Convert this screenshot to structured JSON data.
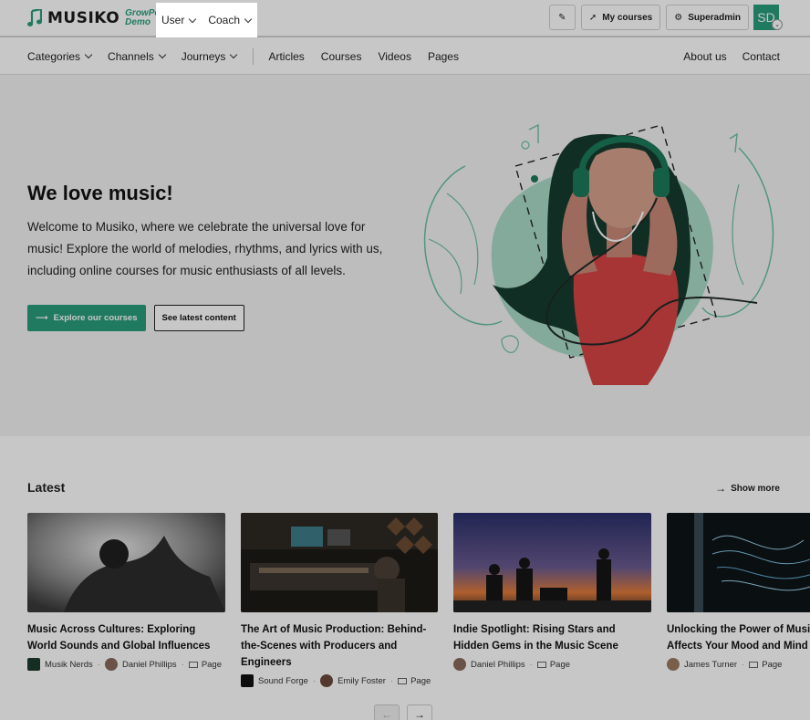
{
  "brand": {
    "name": "MUSIKO",
    "sub_line1": "GrowPoint",
    "sub_line2": "Demo"
  },
  "top_menu": {
    "user": "User",
    "coach": "Coach"
  },
  "top_actions": {
    "my_courses": "My courses",
    "superadmin": "Superadmin",
    "avatar_initials": "SD"
  },
  "nav": {
    "categories": "Categories",
    "channels": "Channels",
    "journeys": "Journeys",
    "articles": "Articles",
    "courses": "Courses",
    "videos": "Videos",
    "pages": "Pages",
    "about": "About us",
    "contact": "Contact"
  },
  "hero": {
    "title": "We love music!",
    "text": "Welcome to Musiko, where we celebrate the universal love for music! Explore the world of melodies, rhythms, and lyrics with us, including online courses for music enthusiasts of all levels.",
    "primary_btn": "Explore our courses",
    "secondary_btn": "See latest content"
  },
  "latest": {
    "title": "Latest",
    "show_more": "Show more",
    "cards": [
      {
        "title": "Music Across Cultures: Exploring World Sounds and Global Influences",
        "channel": "Musik Nerds",
        "author": "Daniel Phillips",
        "type": "Page"
      },
      {
        "title": "The Art of Music Production: Behind-the-Scenes with Producers and Engineers",
        "channel": "Sound Forge",
        "author": "Emily Foster",
        "type": "Page"
      },
      {
        "title": "Indie Spotlight: Rising Stars and Hidden Gems in the Music Scene",
        "author": "Daniel Phillips",
        "type": "Page"
      },
      {
        "title": "Unlocking the Power of Music: How It Affects Your Mood and Mind",
        "author": "James Turner",
        "type": "Page"
      }
    ]
  },
  "colors": {
    "accent": "#2a9d7a",
    "hero_bg": "#f3f3f3",
    "dress": "#d64545"
  }
}
